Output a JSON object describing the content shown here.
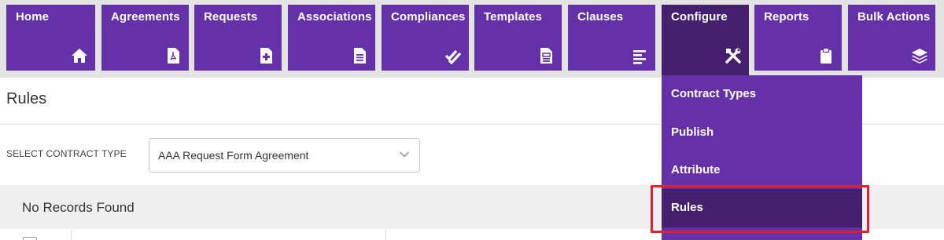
{
  "nav": {
    "items": [
      {
        "label": "Home",
        "icon": "home-icon"
      },
      {
        "label": "Agreements",
        "icon": "pdf-document-icon"
      },
      {
        "label": "Requests",
        "icon": "new-document-icon"
      },
      {
        "label": "Associations",
        "icon": "document-lines-icon"
      },
      {
        "label": "Compliances",
        "icon": "double-check-icon"
      },
      {
        "label": "Templates",
        "icon": "template-document-icon"
      },
      {
        "label": "Clauses",
        "icon": "align-left-icon"
      },
      {
        "label": "Configure",
        "icon": "tools-icon",
        "active": true
      },
      {
        "label": "Reports",
        "icon": "clipboard-icon"
      },
      {
        "label": "Bulk Actions",
        "icon": "layers-icon"
      }
    ]
  },
  "page": {
    "title": "Rules",
    "filter_label": "SELECT CONTRACT TYPE",
    "contract_type_value": "AAA Request Form Agreement",
    "empty_message": "No Records Found"
  },
  "configure_menu": {
    "items": [
      {
        "label": "Contract Types"
      },
      {
        "label": "Publish"
      },
      {
        "label": "Attribute"
      },
      {
        "label": "Rules",
        "active": true
      }
    ]
  },
  "colors": {
    "nav_tile": "#6431a9",
    "nav_tile_active": "#44206f",
    "nav_bar_background": "#e3e3e3",
    "highlight_border": "#e0202d"
  }
}
